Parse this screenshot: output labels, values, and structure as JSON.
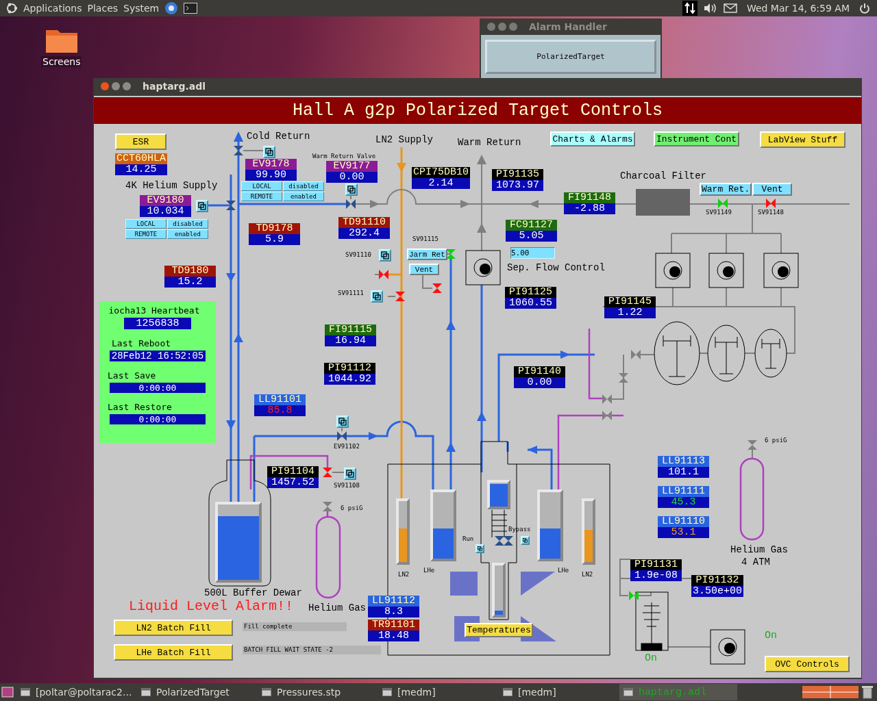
{
  "top_panel": {
    "menus": [
      "Applications",
      "Places",
      "System"
    ],
    "clock": "Wed Mar 14,  6:59 AM"
  },
  "desktop_icons": [
    {
      "label": "Screens"
    }
  ],
  "alarm_handler": {
    "title": "Alarm Handler",
    "button": "PolarizedTarget"
  },
  "window": {
    "title": "haptarg.adl"
  },
  "display": {
    "title": "Hall A g2p Polarized Target Controls",
    "buttons": [
      {
        "label": "ESR",
        "color": "#f5dc40"
      },
      {
        "label": "Charts & Alarms",
        "color": "#a8ffff"
      },
      {
        "label": "Instrument Cont",
        "color": "#70f070"
      },
      {
        "label": "LabView Stuff",
        "color": "#f5dc40"
      },
      {
        "label": "Warm Ret.",
        "color": "#80e0ff"
      },
      {
        "label": "Vent",
        "color": "#80e0ff"
      },
      {
        "label": "Jarm Ret",
        "color": "#80e0ff"
      },
      {
        "label": "Vent",
        "color": "#80e0ff"
      },
      {
        "label": "LN2 Batch Fill",
        "color": "#f5dc40"
      },
      {
        "label": "LHe Batch Fill",
        "color": "#f5dc40"
      },
      {
        "label": "Temperatures",
        "color": "#f5dc40"
      },
      {
        "label": "OVC Controls",
        "color": "#f5dc40"
      }
    ],
    "toggle_groups": [
      {
        "options": [
          "LOCAL",
          "disabled",
          "REMOTE",
          "enabled"
        ]
      },
      {
        "options": [
          "LOCAL",
          "disabled",
          "REMOTE",
          "enabled"
        ]
      }
    ],
    "readouts": [
      {
        "name": {
          "text": "CCT60HLA",
          "color": "#d06010"
        },
        "value": "14.25",
        "kind": "plain"
      },
      {
        "name": {
          "text": "EV9178",
          "color": "#8a1c96"
        },
        "value": "99.90",
        "kind": "plain"
      },
      {
        "name": {
          "text": "EV9177",
          "color": "#8a1c96"
        },
        "value": "0.00",
        "kind": "plain"
      },
      {
        "name": {
          "text": "CPI75DB10",
          "color": "#000000"
        },
        "value": "2.14",
        "kind": "plain"
      },
      {
        "name": {
          "text": "PI91135",
          "color": "#000000"
        },
        "value": "1073.97",
        "kind": "plain"
      },
      {
        "name": {
          "text": "EV9180",
          "color": "#8a1c96"
        },
        "value": "10.034",
        "kind": "plain"
      },
      {
        "name": {
          "text": "FI91148",
          "color": "#1e6a10"
        },
        "value": "-2.88",
        "kind": "plain"
      },
      {
        "name": {
          "text": "TD9178",
          "color": "#a01408"
        },
        "value": "5.9",
        "kind": "plain"
      },
      {
        "name": {
          "text": "TD91110",
          "color": "#a01408"
        },
        "value": "292.4",
        "kind": "plain"
      },
      {
        "name": {
          "text": "FC91127",
          "color": "#1e6a10"
        },
        "value": "5.05",
        "kind": "plain"
      },
      {
        "name": {
          "text": "TD9180",
          "color": "#a01408"
        },
        "value": "15.2",
        "kind": "plain"
      },
      {
        "name": {
          "text": "PI91125",
          "color": "#000000"
        },
        "value": "1060.55",
        "kind": "plain"
      },
      {
        "name": {
          "text": "PI91145",
          "color": "#000000"
        },
        "value": "1.22",
        "kind": "plain"
      },
      {
        "name": {
          "text": "FI91115",
          "color": "#1e6a10"
        },
        "value": "16.94",
        "kind": "plain"
      },
      {
        "name": {
          "text": "PI91112",
          "color": "#000000"
        },
        "value": "1044.92",
        "kind": "plain"
      },
      {
        "name": {
          "text": "PI91140",
          "color": "#000000"
        },
        "value": "0.00",
        "kind": "plain"
      },
      {
        "name": {
          "text": "LL91101",
          "color": "#2b64e0"
        },
        "value": "85.8",
        "kind": "major"
      },
      {
        "name": {
          "text": "LL91113",
          "color": "#2b64e0"
        },
        "value": "101.1",
        "kind": "plain"
      },
      {
        "name": {
          "text": "PI91104",
          "color": "#000000"
        },
        "value": "1457.52",
        "kind": "plain"
      },
      {
        "name": {
          "text": "LL91111",
          "color": "#2b64e0"
        },
        "value": "45.3",
        "kind": "normal"
      },
      {
        "name": {
          "text": "LL91110",
          "color": "#2b64e0"
        },
        "value": "53.1",
        "kind": "minor"
      },
      {
        "name": {
          "text": "PI91131",
          "color": "#000000"
        },
        "value": "1.9e-08",
        "kind": "plain"
      },
      {
        "name": {
          "text": "PI91132",
          "color": "#000000"
        },
        "value": "3.50e+00",
        "kind": "plain"
      },
      {
        "name": {
          "text": "LL91112",
          "color": "#2b64e0"
        },
        "value": "8.3",
        "kind": "plain"
      },
      {
        "name": {
          "text": "TR91101",
          "color": "#a01408"
        },
        "value": "18.48",
        "kind": "plain"
      }
    ],
    "labels": [
      {
        "text": "Cold Return",
        "kind": "heading"
      },
      {
        "text": "LN2 Supply",
        "kind": "heading"
      },
      {
        "text": "Warm Return",
        "kind": "heading"
      },
      {
        "text": "Warm Return Valve",
        "kind": "tag"
      },
      {
        "text": "4K Helium Supply",
        "kind": "heading"
      },
      {
        "text": "Charcoal Filter",
        "kind": "heading"
      },
      {
        "text": "SV91149",
        "kind": "tag"
      },
      {
        "text": "SV91148",
        "kind": "tag"
      },
      {
        "text": "SV91115",
        "kind": "tag"
      },
      {
        "text": "SV91110",
        "kind": "tag"
      },
      {
        "text": "Sep. Flow Control",
        "kind": "heading"
      },
      {
        "text": "SV91111",
        "kind": "tag"
      },
      {
        "text": "EV91102",
        "kind": "tag"
      },
      {
        "text": "SV91108",
        "kind": "tag"
      },
      {
        "text": "6 psiG",
        "kind": "tag"
      },
      {
        "text": "6 psiG",
        "kind": "tag"
      },
      {
        "text": "Run",
        "kind": "tag"
      },
      {
        "text": "Bypass",
        "kind": "tag"
      },
      {
        "text": "LN2",
        "kind": "tag"
      },
      {
        "text": "LHe",
        "kind": "tag"
      },
      {
        "text": "LHe",
        "kind": "tag"
      },
      {
        "text": "LN2",
        "kind": "tag"
      },
      {
        "text": "Helium Gas",
        "kind": "heading"
      },
      {
        "text": "4 ATM",
        "kind": "heading"
      },
      {
        "text": "500L Buffer Dewar",
        "kind": "heading"
      },
      {
        "text": "Liquid Level Alarm!!",
        "kind": "alarm"
      },
      {
        "text": "Helium Gas",
        "kind": "heading"
      },
      {
        "text": "On",
        "kind": "on"
      },
      {
        "text": "On",
        "kind": "on"
      }
    ],
    "heartbeat": {
      "title": "iocha13 Heartbeat",
      "value": "1256838",
      "fields": [
        {
          "label": "Last Reboot",
          "value": "28Feb12 16:52:05"
        },
        {
          "label": "Last Save",
          "value": "0:00:00"
        },
        {
          "label": "Last Restore",
          "value": "0:00:00"
        }
      ]
    },
    "status_messages": [
      "Fill complete",
      "BATCH FILL WAIT STATE -2"
    ],
    "setpoint": {
      "value": "5.00"
    },
    "gauges": [
      {
        "level": 0.85
      },
      {
        "level": 0.55
      },
      {
        "level": 0.45
      },
      {
        "level": 0.95
      },
      {
        "level": 0.45
      },
      {
        "level": 0.53
      },
      {
        "level": 0.08
      }
    ],
    "valves": [
      {
        "color": "#2a4f8a"
      },
      {
        "color": "#2a4f8a"
      },
      {
        "color": "#2a4f8a"
      },
      {
        "color": "#10d010"
      },
      {
        "color": "#ff1010"
      },
      {
        "color": "#10d010"
      },
      {
        "color": "#ff1010"
      },
      {
        "color": "#ff1010"
      },
      {
        "color": "#ff1010"
      },
      {
        "color": "#2a4f8a"
      },
      {
        "color": "#ff1010"
      },
      {
        "color": "#808080"
      },
      {
        "color": "#808080"
      },
      {
        "color": "#808080"
      },
      {
        "color": "#808080"
      },
      {
        "color": "#808080"
      },
      {
        "color": "#808080"
      },
      {
        "color": "#10d010"
      },
      {
        "color": "#2a4f8a"
      },
      {
        "color": "#2a4f8a"
      }
    ]
  },
  "taskbar": {
    "items": [
      {
        "label": "[poltar@poltarac2...",
        "selected": false
      },
      {
        "label": "PolarizedTarget",
        "selected": false
      },
      {
        "label": "Pressures.stp",
        "selected": false
      },
      {
        "label": "[medm]",
        "selected": false
      },
      {
        "label": "[medm]",
        "selected": false
      },
      {
        "label": "haptarg.adl",
        "selected": true
      }
    ]
  }
}
